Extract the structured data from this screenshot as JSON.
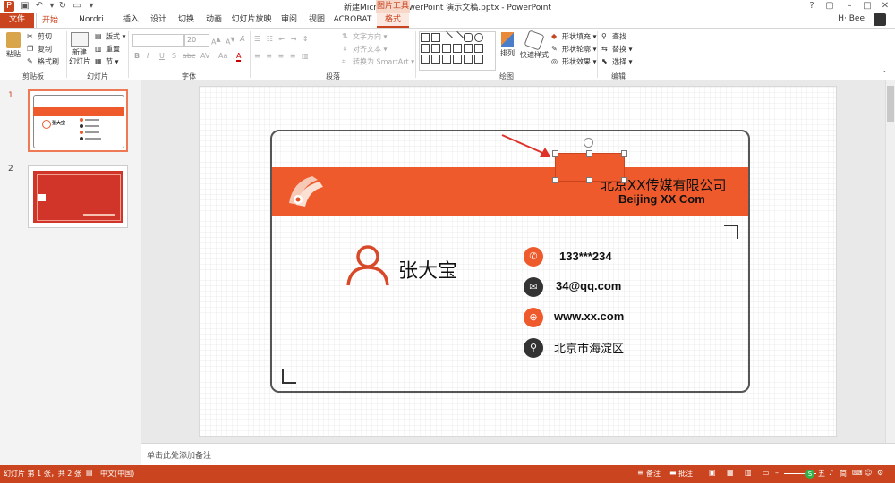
{
  "window": {
    "title": "新建Microsoft PowerPoint 演示文稿.pptx - PowerPoint",
    "context_tool": "图片工具",
    "user": "H· Bee",
    "controls": [
      "?",
      "▢",
      "–",
      "□",
      "✕"
    ]
  },
  "tabs": [
    {
      "label": "文件"
    },
    {
      "label": "开始"
    },
    {
      "label": "Nordri Tools"
    },
    {
      "label": "插入"
    },
    {
      "label": "设计"
    },
    {
      "label": "切换"
    },
    {
      "label": "动画"
    },
    {
      "label": "幻灯片放映"
    },
    {
      "label": "审阅"
    },
    {
      "label": "视图"
    },
    {
      "label": "ACROBAT"
    },
    {
      "label": "格式"
    }
  ],
  "ribbon": {
    "clipboard": {
      "paste": "粘贴",
      "cut": "剪切",
      "copy": "复制",
      "format_painter": "格式刷",
      "label": "剪贴板"
    },
    "slides": {
      "new_slide_line1": "新建",
      "new_slide_line2": "幻灯片",
      "layout": "版式",
      "reset": "重置",
      "section": "节",
      "label": "幻灯片"
    },
    "font": {
      "size": "20",
      "label": "字体",
      "bold": "B",
      "italic": "I",
      "underline": "U",
      "strike": "S",
      "abc": "abc",
      "spacing": "AV",
      "case": "Aa",
      "color": "A"
    },
    "paragraph": {
      "text_direction": "文字方向",
      "align_text": "对齐文本",
      "smartart": "转换为 SmartArt",
      "label": "段落"
    },
    "drawing": {
      "arrange": "排列",
      "quick_styles": "快速样式",
      "fill": "形状填充",
      "outline": "形状轮廓",
      "effects": "形状效果",
      "label": "绘图"
    },
    "editing": {
      "find": "查找",
      "replace": "替换",
      "select": "选择",
      "label": "编辑"
    }
  },
  "slides_panel": [
    {
      "number": "1",
      "name_mini": "张大宝"
    },
    {
      "number": "2"
    }
  ],
  "slide": {
    "company_cn": "北京XX传媒有限公司",
    "company_en": "Beijing XX Com",
    "name": "张大宝",
    "phone": "133***234",
    "email": "34@qq.com",
    "website": "www.xx.com",
    "address": "北京市海淀区"
  },
  "notes": {
    "placeholder": "单击此处添加备注"
  },
  "statusbar": {
    "slide_info": "幻灯片 第 1 张，共 2 张",
    "language": "中文(中国)",
    "notes": "备注",
    "comments": "批注",
    "zoom_tools": [
      "五",
      "♪",
      "简"
    ]
  },
  "colors": {
    "accent": "#c9441f",
    "band": "#ee5a2c",
    "card_border": "#555555",
    "dark_icon": "#333333"
  }
}
